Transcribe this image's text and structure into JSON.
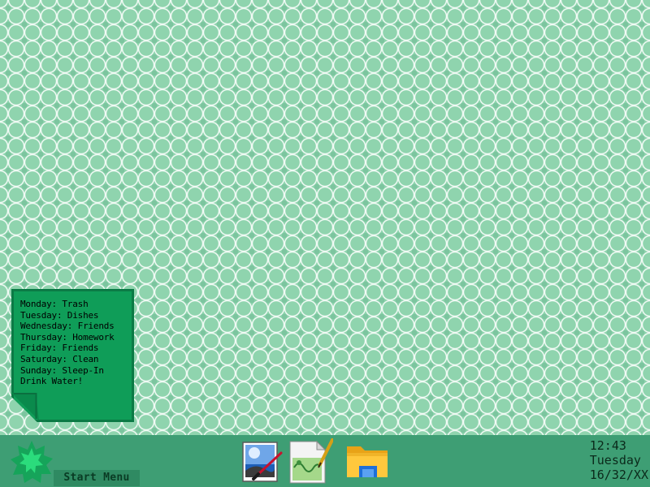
{
  "sticky_note": {
    "lines": [
      "Monday: Trash",
      "Tuesday: Dishes",
      "Wednesday: Friends",
      "Thursday: Homework",
      "Friday: Friends",
      "Saturday: Clean",
      "Sunday: Sleep-In",
      "Drink Water!"
    ]
  },
  "taskbar": {
    "start_label": "Start Menu",
    "start_icon": "star-badge-icon",
    "apps": [
      {
        "icon": "paint-icon"
      },
      {
        "icon": "notepad-icon"
      },
      {
        "icon": "file-explorer-icon"
      }
    ],
    "clock": {
      "time": "12:43",
      "day": "Tuesday",
      "date": "16/32/XX"
    }
  },
  "colors": {
    "desktop_bg": "#8fd4ae",
    "taskbar_bg": "#3e9e74",
    "note_bg": "#0f9d58",
    "note_border": "#0b7a45",
    "start_label_bg": "#2f8a62"
  }
}
